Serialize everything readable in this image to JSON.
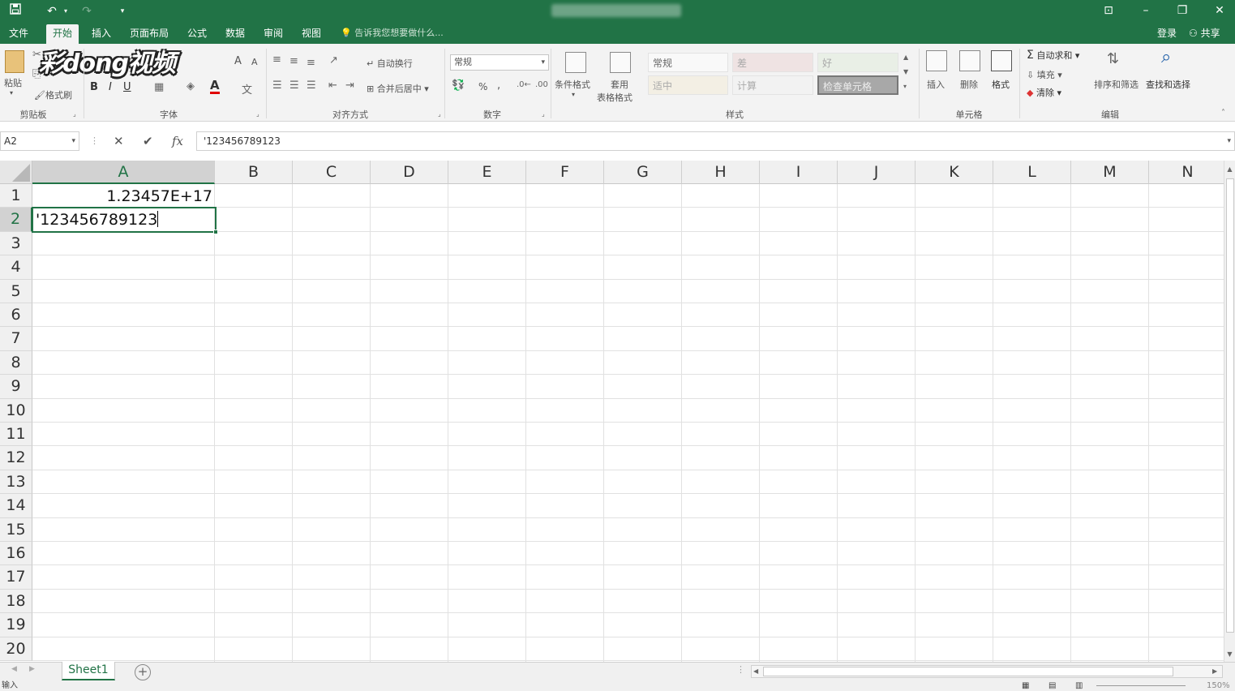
{
  "colors": {
    "accent": "#217346",
    "selection": "#217346"
  },
  "titlebar": {
    "save_icon": "save-icon",
    "undo_icon": "undo-icon",
    "redo_icon": "redo-icon",
    "ribbon_display_icon": "ribbon-display-options-icon"
  },
  "tabs": [
    {
      "label": "文件"
    },
    {
      "label": "开始"
    },
    {
      "label": "插入"
    },
    {
      "label": "页面布局"
    },
    {
      "label": "公式"
    },
    {
      "label": "数据"
    },
    {
      "label": "审阅"
    },
    {
      "label": "视图"
    }
  ],
  "tellme": "告诉我您想要做什么...",
  "account": {
    "login": "登录",
    "share": "共享"
  },
  "watermark": "彩dong视频",
  "ribbon": {
    "clipboard": {
      "paste": "粘贴",
      "format_painter": "格式刷",
      "label": "剪贴板"
    },
    "font": {
      "label": "字体",
      "bold": "B",
      "italic": "I",
      "underline": "U",
      "grow": "A",
      "shrink": "A",
      "color": "A"
    },
    "alignment": {
      "label": "对齐方式",
      "wrap": "自动换行",
      "merge": "合并后居中"
    },
    "number": {
      "label": "数字",
      "format": "常规",
      "percent": "%",
      "comma": ","
    },
    "styles": {
      "label": "样式",
      "conditional": "条件格式",
      "table1": "套用",
      "table2": "表格格式",
      "cells": [
        "常规",
        "差",
        "好",
        "适中",
        "计算",
        "检查单元格"
      ]
    },
    "cells": {
      "label": "单元格",
      "insert": "插入",
      "delete": "删除",
      "format": "格式"
    },
    "editing": {
      "label": "编辑",
      "autosum": "自动求和",
      "fill": "填充",
      "clear": "清除",
      "sort": "排序和筛选",
      "find": "查找和选择"
    }
  },
  "formula_bar": {
    "name_box": "A2",
    "cancel": "✕",
    "enter": "✔",
    "fx": "fx",
    "content": "'123456789123"
  },
  "columns": [
    "A",
    "B",
    "C",
    "D",
    "E",
    "F",
    "G",
    "H",
    "I",
    "J",
    "K",
    "L",
    "M",
    "N"
  ],
  "rows": [
    "1",
    "2",
    "3",
    "4",
    "5",
    "6",
    "7",
    "8",
    "9",
    "10",
    "11",
    "12",
    "13",
    "14",
    "15",
    "16",
    "17",
    "18",
    "19",
    "20"
  ],
  "cells": {
    "A1": "1.23457E+17",
    "A2": "'123456789123"
  },
  "selected_cell": "A2",
  "sheets": [
    {
      "name": "Sheet1"
    }
  ],
  "status": {
    "mode": "输入",
    "zoom": "150%"
  }
}
